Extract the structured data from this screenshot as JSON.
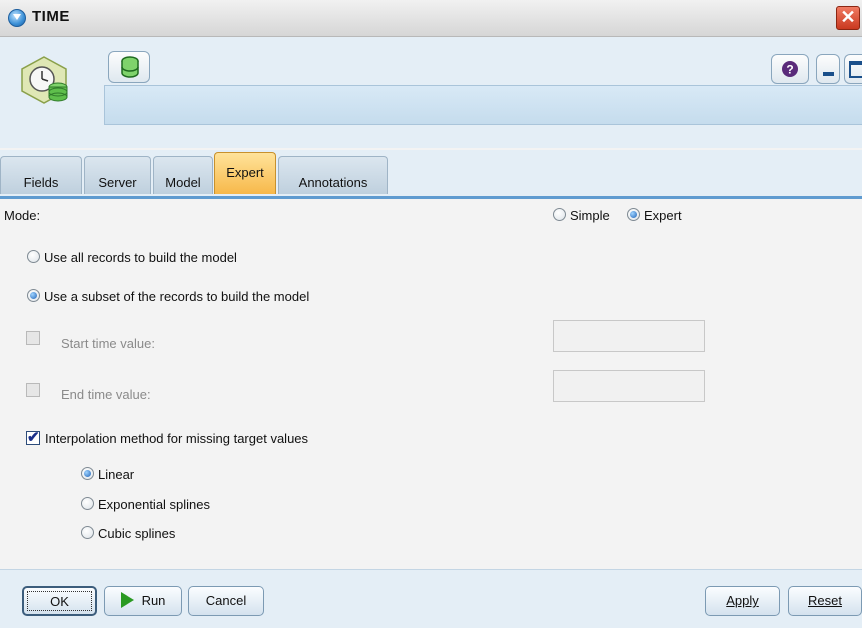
{
  "window": {
    "title": "TIME",
    "title_icon": "node-icon",
    "close_icon": "close-icon"
  },
  "header": {
    "node_icon": "time-node-icon",
    "db_icon": "database-icon",
    "help_icon": "question-icon",
    "minimize_icon": "minimize-icon",
    "maximize_icon": "maximize-icon"
  },
  "tabs": [
    {
      "label": "Fields",
      "active": false
    },
    {
      "label": "Server",
      "active": false
    },
    {
      "label": "Model",
      "active": false
    },
    {
      "label": "Expert",
      "active": true
    },
    {
      "label": "Annotations",
      "active": false
    }
  ],
  "mode": {
    "label": "Mode:",
    "simple_label": "Simple",
    "expert_label": "Expert",
    "selected": "Expert"
  },
  "records": {
    "all_label": "Use all records to build the model",
    "subset_label": "Use a subset of the records to build the model",
    "selected": "subset"
  },
  "time_range": {
    "start_label": "Start time value:",
    "start_checked": false,
    "start_value": "",
    "end_label": "End time value:",
    "end_checked": false,
    "end_value": ""
  },
  "interpolation": {
    "label": "Interpolation method for missing target values",
    "checked": true,
    "options": [
      "Linear",
      "Exponential splines",
      "Cubic splines"
    ],
    "selected": "Linear"
  },
  "buttons": {
    "ok": "OK",
    "run": "Run",
    "cancel": "Cancel",
    "apply": "Apply",
    "reset": "Reset"
  },
  "colors": {
    "active_tab": "#f7b84a",
    "accent": "#5f9bd0",
    "close": "#c9391f",
    "run_icon": "#2a9a22"
  }
}
